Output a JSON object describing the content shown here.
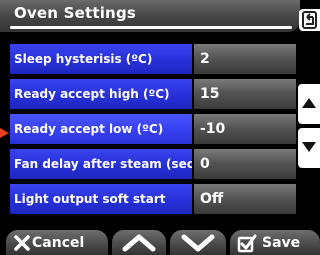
{
  "header": {
    "title": "Oven Settings"
  },
  "settings": [
    {
      "label": "Sleep hysterisis (ºC)",
      "value": "2"
    },
    {
      "label": "Ready accept high (ºC)",
      "value": "15"
    },
    {
      "label": "Ready accept low (ºC)",
      "value": "-10"
    },
    {
      "label": "Fan delay after steam (sec)",
      "value": "0"
    },
    {
      "label": "Light output soft start",
      "value": "Off"
    }
  ],
  "footer": {
    "cancel_label": "Cancel",
    "save_label": "Save"
  },
  "colors": {
    "label_bg": "#2730d8",
    "pointer": "#e8401c",
    "background": "#000000"
  },
  "icons": {
    "back": "back-arrow-icon",
    "up": "chevron-up-icon",
    "down": "chevron-down-icon",
    "cancel": "x-icon",
    "save": "checkbox-check-icon"
  }
}
